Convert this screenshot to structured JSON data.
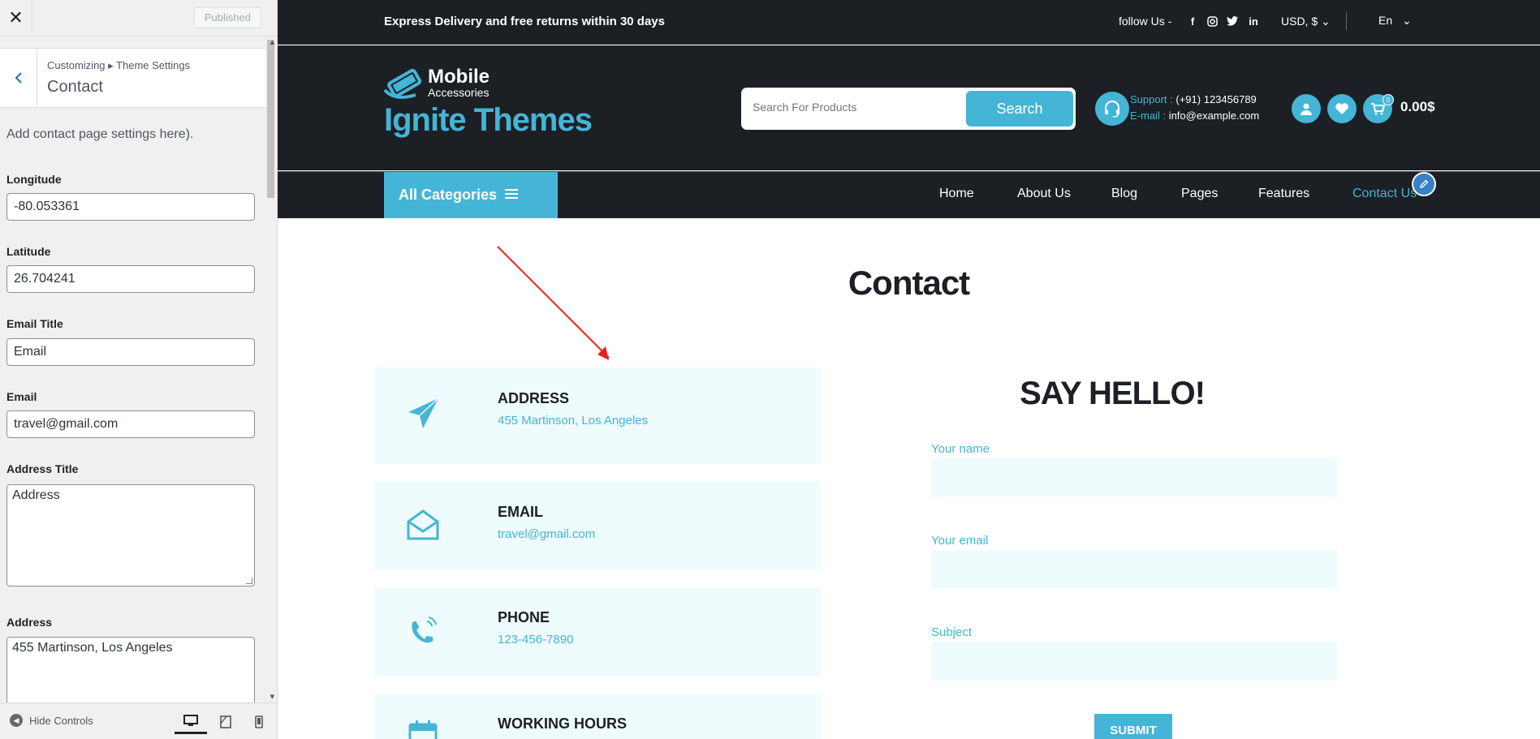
{
  "customizer": {
    "close_icon": "close-icon",
    "publish_label": "Published",
    "breadcrumb": "Customizing ▸ Theme Settings",
    "section_title": "Contact",
    "description": "Add contact page settings here).",
    "fields": {
      "longitude": {
        "label": "Longitude",
        "value": "-80.053361"
      },
      "latitude": {
        "label": "Latitude",
        "value": "26.704241"
      },
      "email_title": {
        "label": "Email Title",
        "value": "Email"
      },
      "email": {
        "label": "Email",
        "value": "travel@gmail.com"
      },
      "address_title": {
        "label": "Address Title",
        "value": "Address"
      },
      "address": {
        "label": "Address",
        "value": "455 Martinson, Los Angeles"
      }
    },
    "footer": {
      "hide_controls": "Hide Controls",
      "devices": [
        "desktop",
        "tablet",
        "mobile"
      ],
      "active_device": "desktop"
    }
  },
  "site": {
    "topbar": {
      "promo": "Express Delivery and free returns within 30 days",
      "follow": "follow Us -",
      "social": [
        "facebook",
        "instagram",
        "twitter",
        "linkedin"
      ],
      "currency": "USD, $",
      "language": "En"
    },
    "logo": {
      "line1": "Mobile",
      "line2": "Accessories",
      "brand": "Ignite Themes"
    },
    "search": {
      "placeholder": "Search For Products",
      "button": "Search"
    },
    "support": {
      "phone_label": "Support :",
      "phone": "(+91) 123456789",
      "email_label": "E-mail :",
      "email": "info@example.com"
    },
    "cart": {
      "count": "0",
      "total": "0.00$"
    },
    "nav": {
      "all_categories": "All Categories",
      "links": [
        "Home",
        "About Us",
        "Blog",
        "Pages",
        "Features",
        "Contact Us"
      ],
      "active": "Contact Us"
    },
    "page_title": "Contact",
    "info_cards": [
      {
        "icon": "paper-plane-icon",
        "title": "ADDRESS",
        "value": "455 Martinson, Los Angeles"
      },
      {
        "icon": "envelope-open-icon",
        "title": "EMAIL",
        "value": "travel@gmail.com"
      },
      {
        "icon": "phone-icon",
        "title": "PHONE",
        "value": "123-456-7890"
      },
      {
        "icon": "calendar-icon",
        "title": "WORKING HOURS",
        "value": ""
      }
    ],
    "form": {
      "heading": "SAY HELLO!",
      "name_label": "Your name",
      "email_label": "Your email",
      "subject_label": "Subject",
      "submit": "SUBMIT"
    }
  },
  "colors": {
    "accent": "#44b5d6",
    "dark": "#1c1f24",
    "card_bg": "#effcfd",
    "wp_blue": "#2271b1",
    "annotation_arrow": "#e8221f"
  }
}
